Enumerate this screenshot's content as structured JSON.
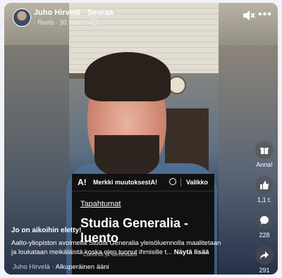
{
  "header": {
    "author_name": "Juho Hirvelä",
    "separator": " · ",
    "follow_label": "Seuraa",
    "meta": "· Reels · 30. touko ·",
    "mute_icon": "speaker-muted-icon",
    "more_icon": "more-icon"
  },
  "website": {
    "logo": "A!",
    "announcement": "Merkki muutoksestA!",
    "search_icon": "search-icon",
    "menu_label": "Valikko",
    "section_link": "Tapahtumat",
    "title": "Studia Generalia - luento",
    "subtitle": "Luennot ja seminaarit"
  },
  "actions": {
    "gift": {
      "icon": "gift-icon",
      "label": "Anna!"
    },
    "like": {
      "icon": "thumbs-up-icon",
      "label": "1,1 t."
    },
    "comment": {
      "icon": "comment-icon",
      "label": "228"
    },
    "share": {
      "icon": "share-icon",
      "label": "291"
    }
  },
  "caption": {
    "title": "Jo on aikoihin eletty!",
    "line1": "Aalto-yliopiston avoimella Studia Generalia yleisöluennolla maalitetaan",
    "line2": "ja loukataan meikäläistä koska olen tuonut ihmisille t...",
    "more_label": "Näytä lisää"
  },
  "audio": {
    "artist": "Juho Hirvelä",
    "separator": " · ",
    "track": "Alkuperäinen ääni"
  }
}
